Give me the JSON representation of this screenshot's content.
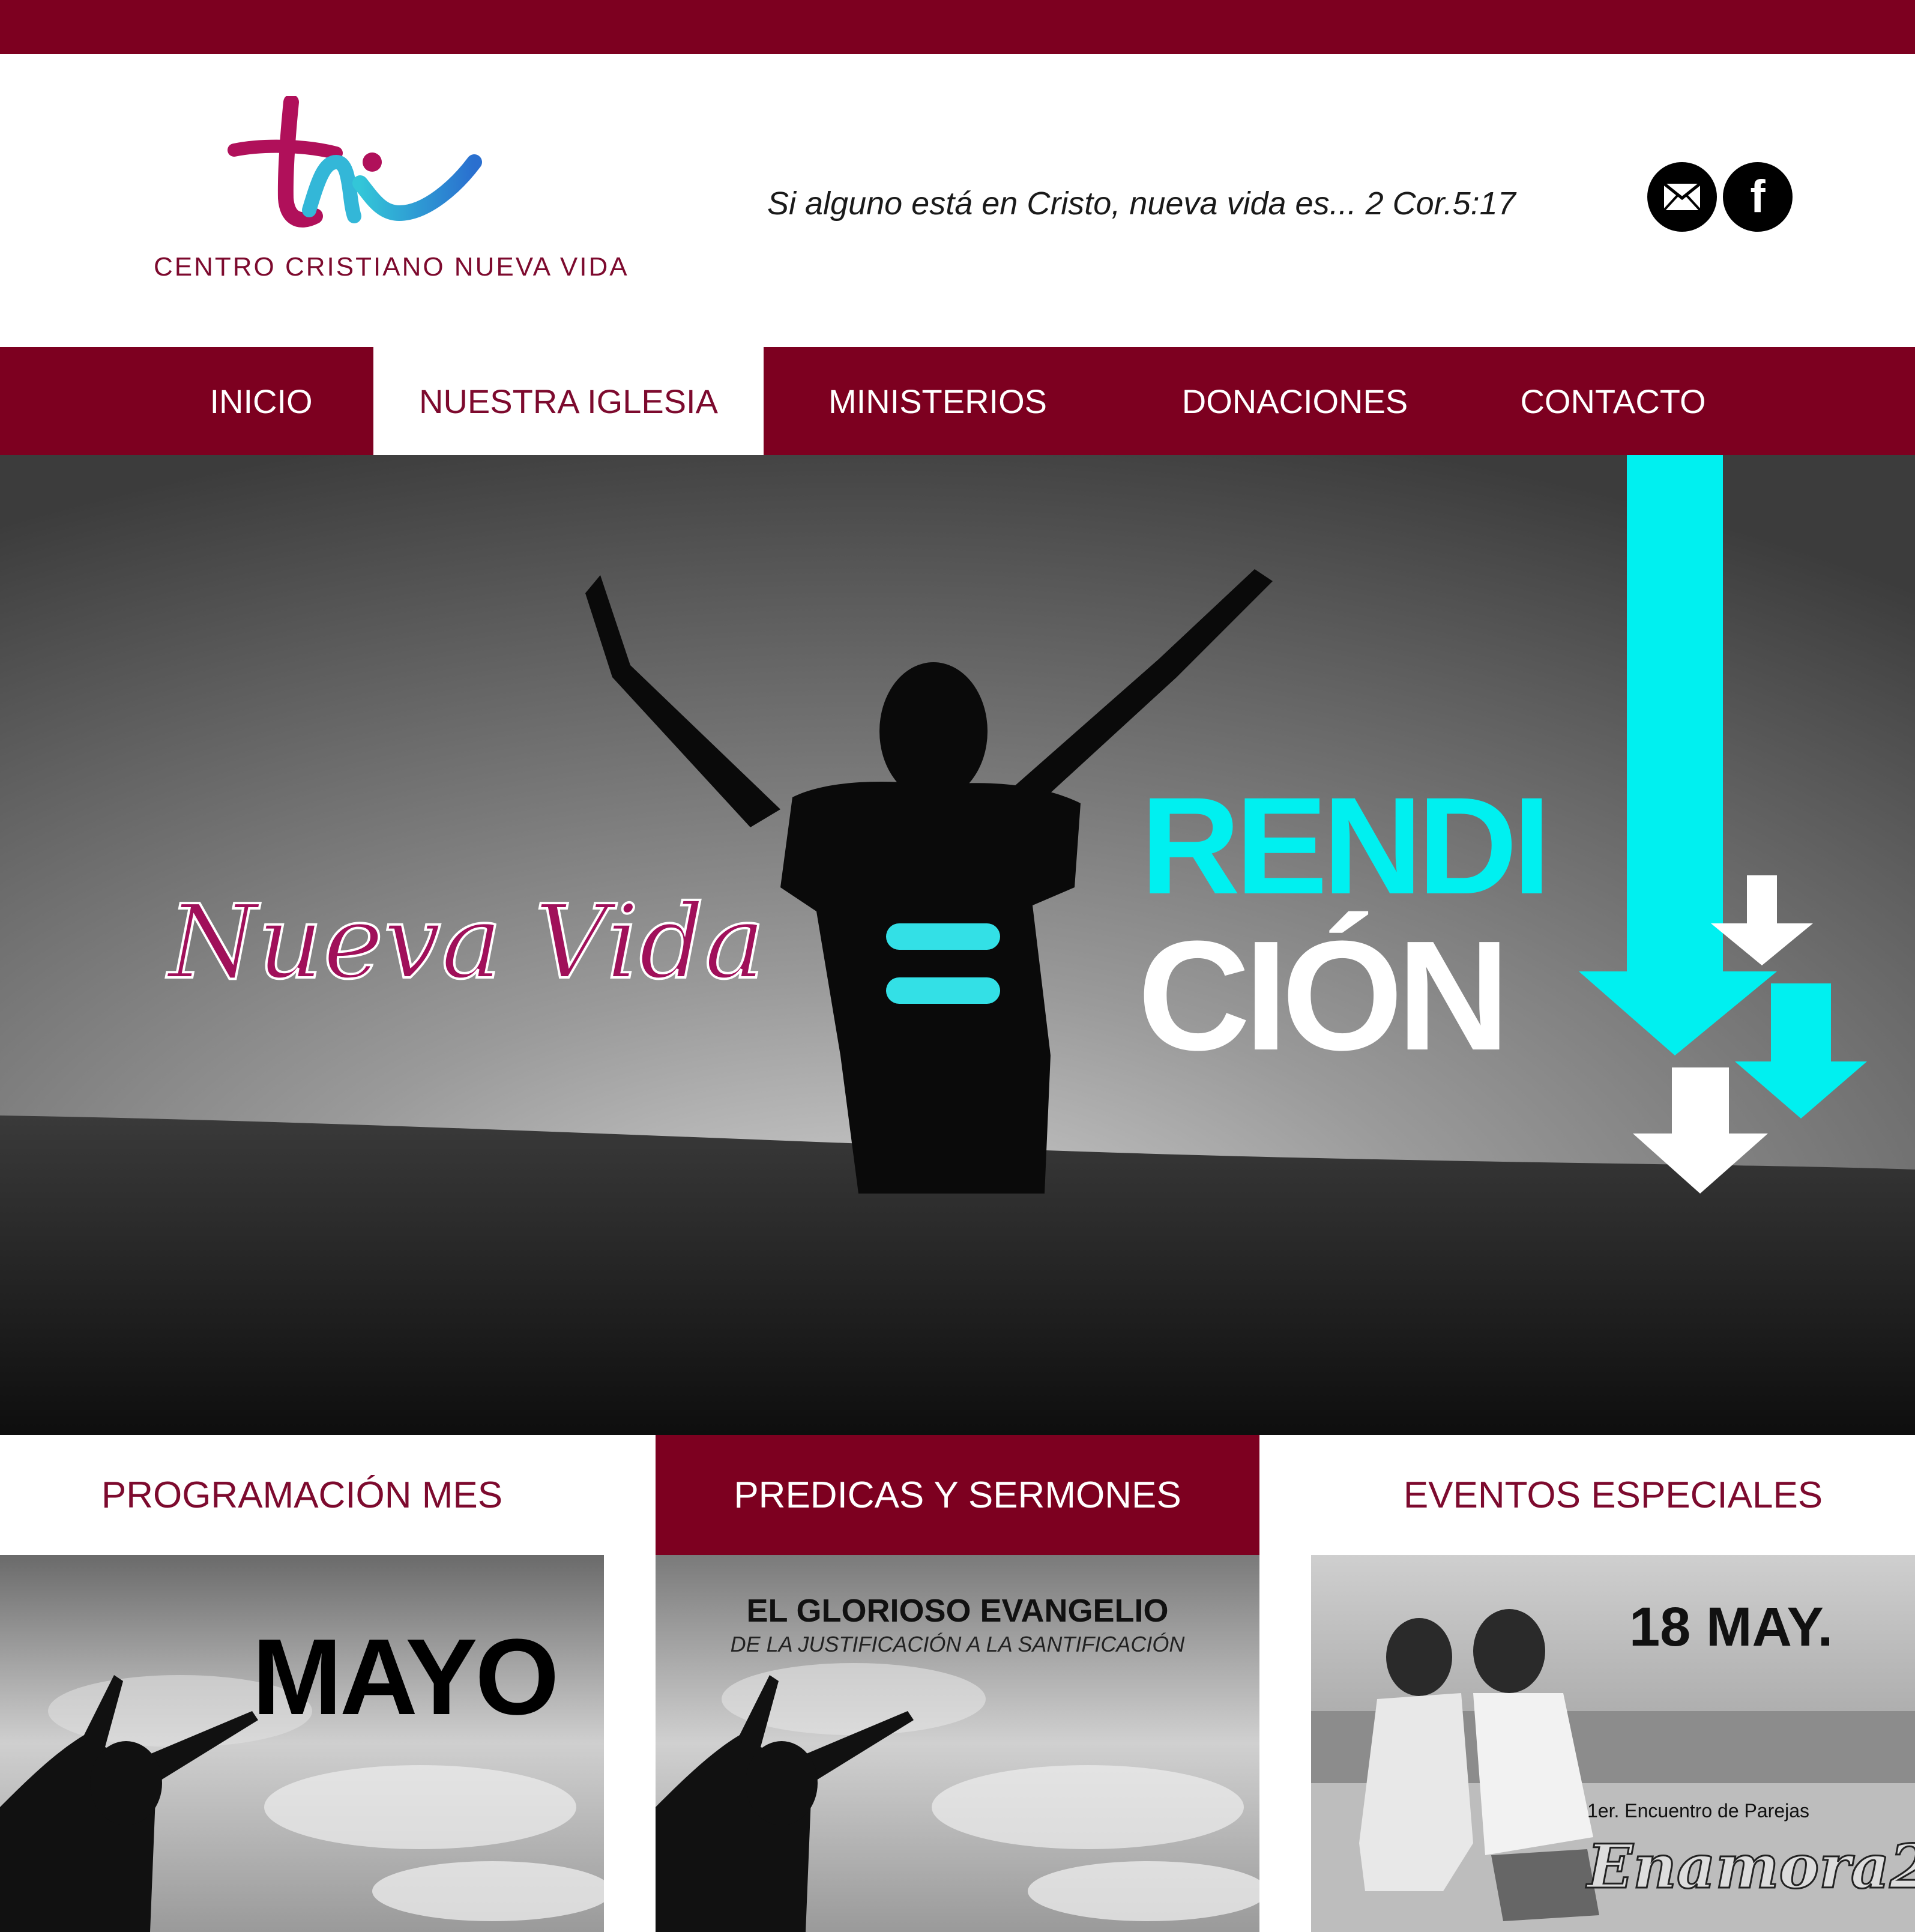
{
  "brand": {
    "logo_mark": "tnv",
    "name": "CENTRO CRISTIANO NUEVA VIDA",
    "colors": {
      "primary": "#7d0020",
      "accent_cyan": "#00f0f0",
      "magenta": "#b0105a",
      "blue": "#2b7fd4"
    }
  },
  "header": {
    "tagline": "Si alguno está en Cristo, nueva vida es... 2 Cor.5:17",
    "social": [
      {
        "icon": "envelope-icon"
      },
      {
        "icon": "facebook-icon",
        "glyph": "f"
      }
    ]
  },
  "nav": {
    "items": [
      {
        "label": "INICIO",
        "active": false
      },
      {
        "label": "NUESTRA IGLESIA",
        "active": true
      },
      {
        "label": "MINISTERIOS",
        "active": false
      },
      {
        "label": "DONACIONES",
        "active": false
      },
      {
        "label": "CONTACTO",
        "active": false
      }
    ]
  },
  "hero": {
    "left_text": "Nueva Vida",
    "right_text_1": "RENDI",
    "right_text_2": "CIÓN"
  },
  "cards": [
    {
      "title": "PROGRAMACIÓN MES",
      "active": false,
      "image_text": "MAYO"
    },
    {
      "title": "PREDICAS Y SERMONES",
      "active": true,
      "image_text": "EL GLORIOSO EVANGELIO",
      "image_subtext": "DE LA JUSTIFICACIÓN A LA SANTIFICACIÓN"
    },
    {
      "title": "EVENTOS ESPECIALES",
      "active": false,
      "image_text": "18 MAY.",
      "image_subtext": "1er. Encuentro de Parejas",
      "image_name": "Enamora2"
    }
  ]
}
